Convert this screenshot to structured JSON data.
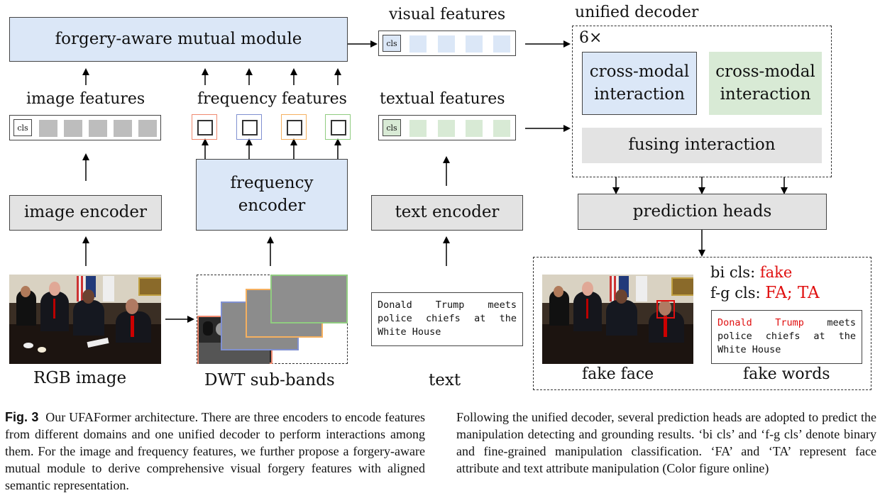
{
  "diagram": {
    "modules": {
      "forgery_mutual": "forgery-aware mutual module",
      "image_encoder": "image encoder",
      "frequency_encoder": "frequency encoder",
      "text_encoder": "text encoder",
      "unified_decoder_title": "unified decoder",
      "repeat": "6×",
      "cross_modal_1": "cross-modal interaction",
      "cross_modal_2": "cross-modal interaction",
      "fusing": "fusing interaction",
      "prediction_heads": "prediction heads"
    },
    "feature_labels": {
      "image": "image features",
      "frequency": "frequency features",
      "visual": "visual features",
      "textual": "textual features",
      "cls_token": "cls"
    },
    "inputs": {
      "rgb_label": "RGB image",
      "dwt_label": "DWT sub-bands",
      "text_label": "text",
      "text_content": "Donald Trump meets police chiefs at the White House"
    },
    "outputs": {
      "bi_cls_label": "bi cls:",
      "bi_cls_value": "fake",
      "fg_cls_label": "f-g cls:",
      "fg_cls_value": "FA; TA",
      "fake_words_highlight": "Donald Trump",
      "fake_words_rest": " meets police chiefs at the White House",
      "fake_face_label": "fake face",
      "fake_words_label": "fake words"
    },
    "colors": {
      "blue_fill": "#dbe7f7",
      "green_fill": "#d8ead5",
      "gray_fill": "#e3e3e3",
      "token_gray": "#bdbdbd",
      "sub_band_ll": "#f08a70",
      "sub_band_lh": "#8090d0",
      "sub_band_hl": "#f5b060",
      "sub_band_hh": "#90cc80",
      "fake_red": "#e01010"
    }
  },
  "caption": {
    "fig_label": "Fig. 3",
    "left": "Our UFAFormer architecture. There are three encoders to encode features from different domains and one unified decoder to perform interactions among them. For the image and frequency features, we further propose a forgery-aware mutual module to derive comprehensive visual forgery features with aligned semantic representation.",
    "right": "Following the unified decoder, several prediction heads are adopted to predict the manipulation detecting and grounding results. ‘bi cls’ and ‘f-g cls’ denote binary and fine-grained manipulation classification. ‘FA’ and ‘TA’ represent face attribute and text attribute manipulation (Color figure online)"
  }
}
